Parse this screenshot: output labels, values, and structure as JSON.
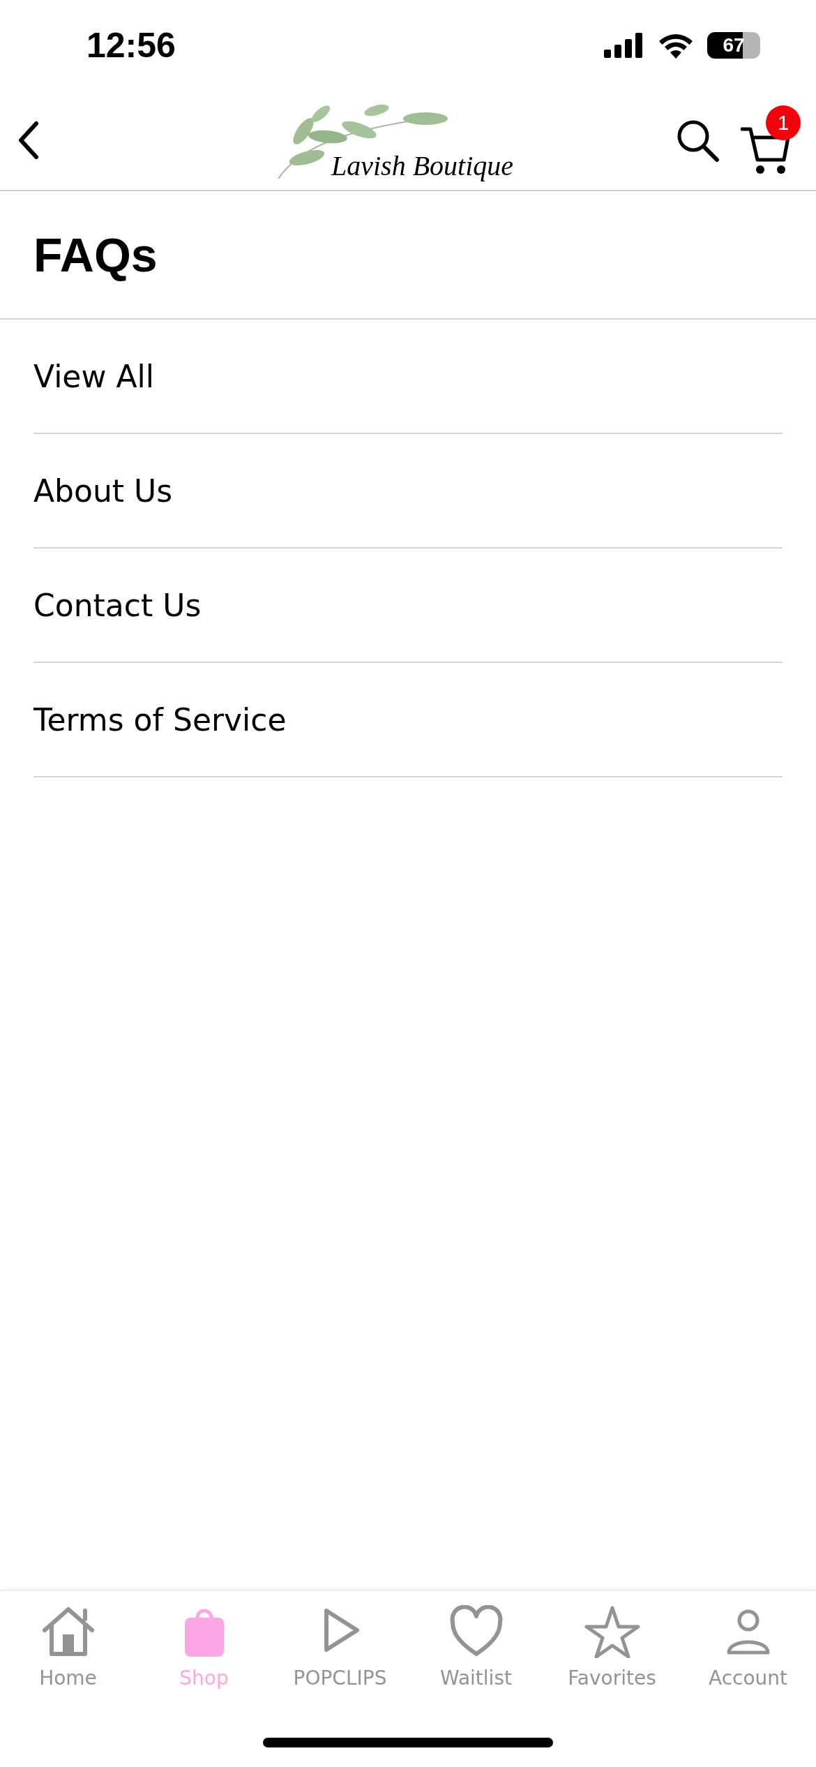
{
  "status_bar": {
    "time": "12:56",
    "battery": "67"
  },
  "header": {
    "logo": "Lavish Boutique",
    "cart_count": "1"
  },
  "page_title": "FAQs",
  "links": [
    {
      "label": "View All"
    },
    {
      "label": "About Us"
    },
    {
      "label": "Contact Us"
    },
    {
      "label": "Terms of Service"
    }
  ],
  "tab_bar": [
    {
      "kind": "home",
      "label": "Home",
      "selected": false
    },
    {
      "kind": "shop",
      "label": "Shop",
      "selected": true
    },
    {
      "kind": "play",
      "label": "POPCLIPS",
      "selected": false
    },
    {
      "kind": "heart",
      "label": "Waitlist",
      "selected": false
    },
    {
      "kind": "star",
      "label": "Favorites",
      "selected": false
    },
    {
      "kind": "person",
      "label": "Account",
      "selected": false
    }
  ]
}
